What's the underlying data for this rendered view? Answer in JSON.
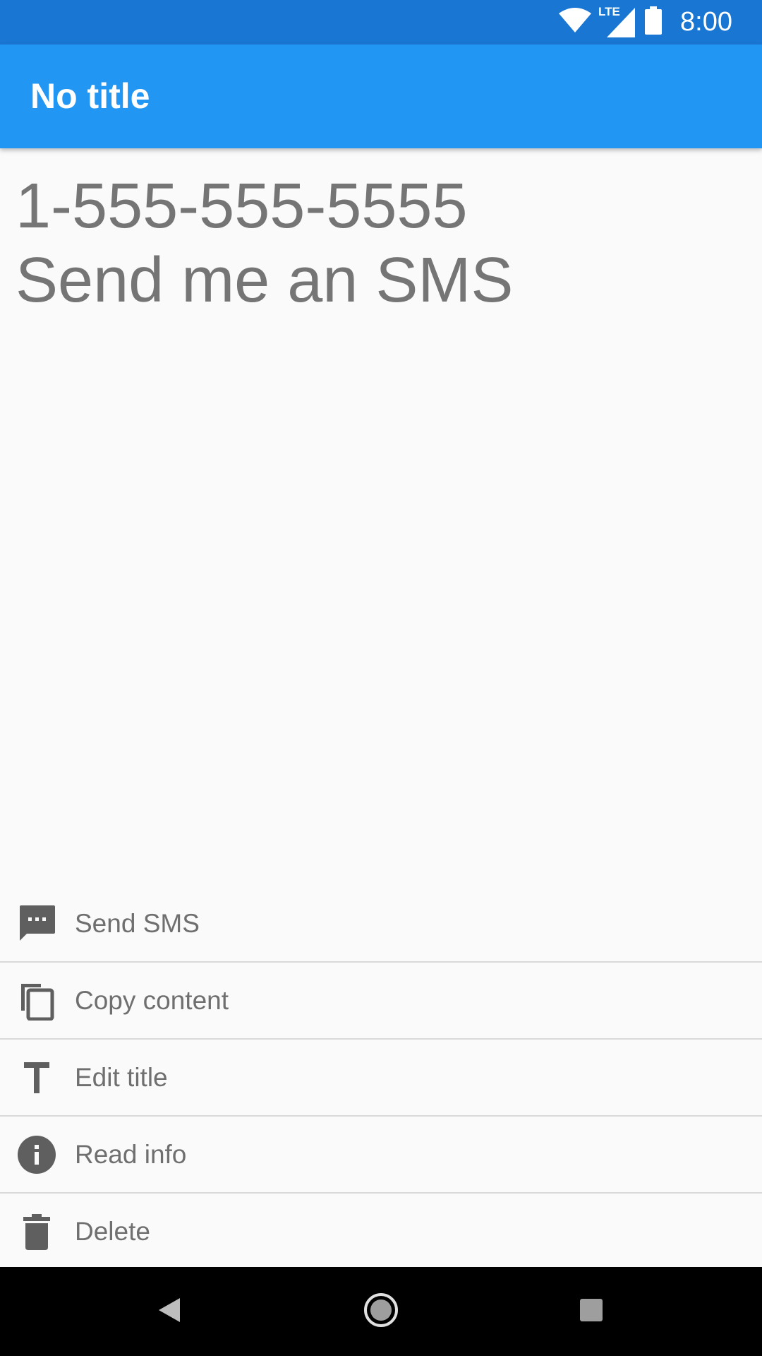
{
  "status_bar": {
    "time": "8:00",
    "network_label": "LTE",
    "icons": [
      "wifi-icon",
      "cell-signal-icon",
      "battery-icon"
    ]
  },
  "app_bar": {
    "title": "No title"
  },
  "content": {
    "phone_number": "1-555-555-5555",
    "message": "Send me an SMS"
  },
  "actions": [
    {
      "label": "Send SMS",
      "icon": "sms-icon"
    },
    {
      "label": "Copy content",
      "icon": "copy-icon"
    },
    {
      "label": "Edit title",
      "icon": "text-format-icon"
    },
    {
      "label": "Read info",
      "icon": "info-icon"
    },
    {
      "label": "Delete",
      "icon": "trash-icon"
    }
  ],
  "nav_bar": {
    "buttons": [
      "back-icon",
      "home-icon",
      "recents-icon"
    ]
  },
  "colors": {
    "status_bar": "#1976d2",
    "app_bar": "#2196f3",
    "background": "#fafafa",
    "text": "#757575",
    "icon": "#5f5f5f"
  }
}
